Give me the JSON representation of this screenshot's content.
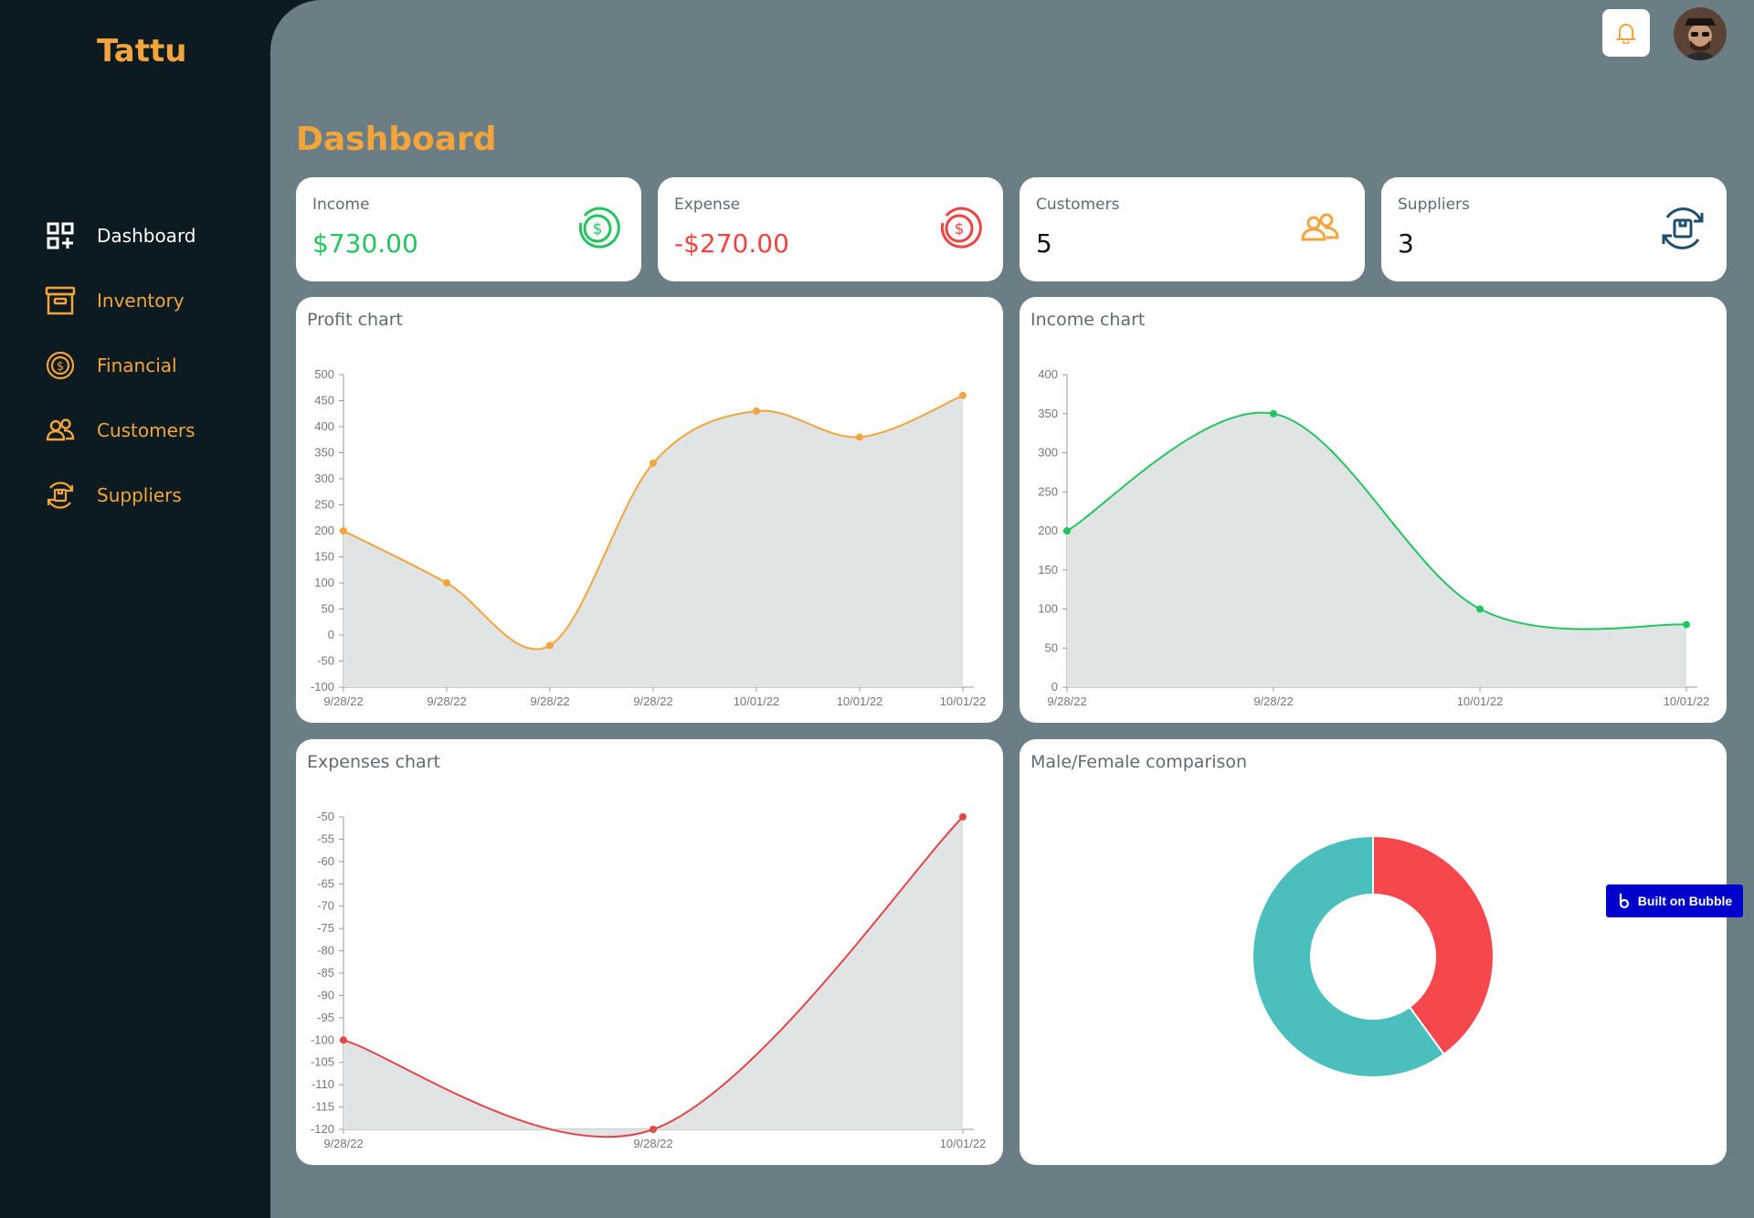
{
  "brand": "Tattu",
  "sidebar": {
    "items": [
      {
        "label": "Dashboard",
        "icon": "dashboard-grid-icon",
        "active": true
      },
      {
        "label": "Inventory",
        "icon": "archive-box-icon"
      },
      {
        "label": "Financial",
        "icon": "dollar-coin-icon"
      },
      {
        "label": "Customers",
        "icon": "users-icon"
      },
      {
        "label": "Suppliers",
        "icon": "supplier-box-icon"
      }
    ]
  },
  "header": {
    "bell_icon": "bell-icon",
    "avatar": "user-avatar"
  },
  "page_title": "Dashboard",
  "stats": [
    {
      "label": "Income",
      "value": "$730.00",
      "color": "#22c55e",
      "icon": "dollar-coin-icon"
    },
    {
      "label": "Expense",
      "value": "-$270.00",
      "color": "#f04444",
      "icon": "dollar-coin-icon"
    },
    {
      "label": "Customers",
      "value": "5",
      "color": "#111111",
      "icon": "users-icon"
    },
    {
      "label": "Suppliers",
      "value": "3",
      "color": "#111111",
      "icon": "supplier-box-icon"
    }
  ],
  "colors": {
    "accent": "#f3a53c",
    "sidebar_bg": "#0c1b21",
    "main_bg": "#6b7d85",
    "profit": "#f3a53c",
    "income": "#22c55e",
    "expense": "#e34646",
    "male": "#4abfbe",
    "female": "#f5474c"
  },
  "charts": {
    "profit": {
      "title": "Profit chart"
    },
    "income": {
      "title": "Income chart"
    },
    "expenses": {
      "title": "Expenses chart"
    },
    "gender": {
      "title": "Male/Female comparison"
    }
  },
  "chart_data": [
    {
      "type": "area",
      "title": "Profit chart",
      "x": [
        "9/28/22",
        "9/28/22",
        "9/28/22",
        "9/28/22",
        "10/01/22",
        "10/01/22",
        "10/01/22"
      ],
      "values": [
        200,
        100,
        -20,
        330,
        430,
        380,
        460
      ],
      "ylim": [
        -100,
        500
      ],
      "yticks": [
        -100,
        -50,
        0,
        50,
        100,
        150,
        200,
        250,
        300,
        350,
        400,
        450,
        500
      ],
      "xlabel": "",
      "ylabel": ""
    },
    {
      "type": "area",
      "title": "Income chart",
      "x": [
        "9/28/22",
        "9/28/22",
        "10/01/22",
        "10/01/22"
      ],
      "values": [
        200,
        350,
        100,
        80
      ],
      "ylim": [
        0,
        400
      ],
      "yticks": [
        0,
        50,
        100,
        150,
        200,
        250,
        300,
        350,
        400
      ],
      "xlabel": "",
      "ylabel": ""
    },
    {
      "type": "area",
      "title": "Expenses chart",
      "x": [
        "9/28/22",
        "9/28/22",
        "10/01/22"
      ],
      "values": [
        -100,
        -120,
        -50
      ],
      "ylim": [
        -120,
        -50
      ],
      "yticks": [
        -120,
        -115,
        -110,
        -105,
        -100,
        -95,
        -90,
        -85,
        -80,
        -75,
        -70,
        -65,
        -60,
        -55,
        -50
      ],
      "xlabel": "",
      "ylabel": ""
    },
    {
      "type": "pie",
      "title": "Male/Female comparison",
      "donut": true,
      "slices": [
        {
          "color": "#f5474c",
          "value": 40
        },
        {
          "color": "#4abfbe",
          "value": 60
        }
      ]
    }
  ],
  "badge": {
    "label": "Built on Bubble"
  }
}
